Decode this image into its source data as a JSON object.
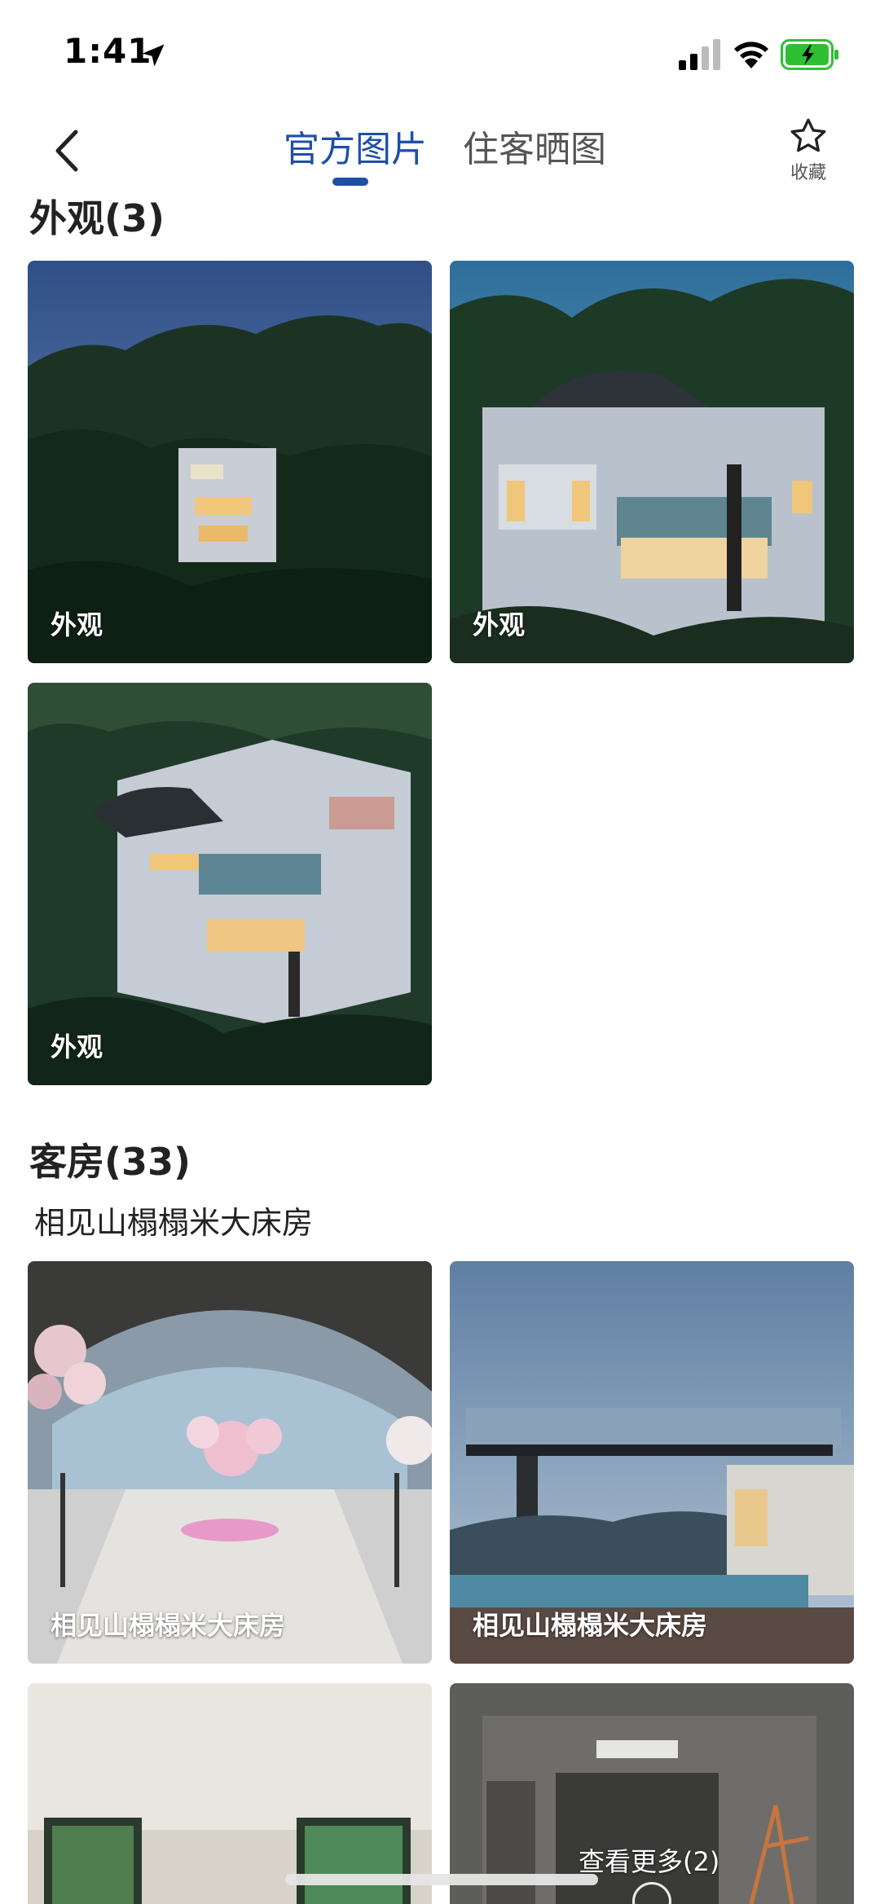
{
  "status_bar": {
    "time": "1:41"
  },
  "nav": {
    "tabs": [
      {
        "label": "官方图片",
        "active": true
      },
      {
        "label": "住客晒图",
        "active": false
      }
    ],
    "favorite_label": "收藏",
    "accent_color": "#1e4fa8"
  },
  "sections": {
    "exterior": {
      "title": "外观(3)",
      "photos": [
        {
          "label": "外观"
        },
        {
          "label": "外观"
        },
        {
          "label": "外观"
        }
      ]
    },
    "rooms": {
      "title": "客房(33)",
      "room_type": "相见山榻榻米大床房",
      "photos": [
        {
          "label": "相见山榻榻米大床房"
        },
        {
          "label": "相见山榻榻米大床房"
        }
      ]
    }
  },
  "more_button": "查看更多(2)"
}
